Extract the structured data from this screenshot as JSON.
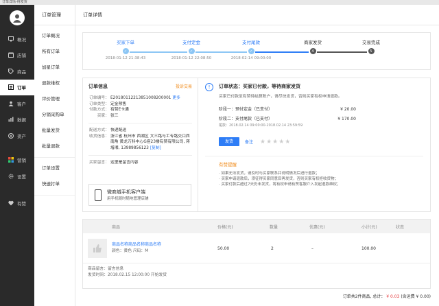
{
  "window": {
    "title": "订单详情-待发货"
  },
  "sidebar": {
    "items": [
      {
        "label": "概况",
        "icon": "monitor-icon"
      },
      {
        "label": "店铺",
        "icon": "store-icon"
      },
      {
        "label": "商品",
        "icon": "tag-icon"
      },
      {
        "label": "订单",
        "icon": "list-icon",
        "active": true
      },
      {
        "label": "客户",
        "icon": "user-icon"
      },
      {
        "label": "数据",
        "icon": "chart-icon"
      },
      {
        "label": "资产",
        "icon": "money-icon"
      },
      {
        "label": "营销",
        "icon": "grid-icon"
      },
      {
        "label": "设置",
        "icon": "gear-icon"
      },
      {
        "label": "有赞",
        "icon": "heart-icon"
      }
    ]
  },
  "subnav": {
    "title": "订单管理",
    "groups": [
      [
        "订单概况",
        "所有订单",
        "加星订单",
        "退款维权",
        "评价管理",
        "分销采购单",
        "批量发货",
        "批量退款"
      ],
      [
        "订单设置",
        "快速打单"
      ]
    ]
  },
  "main": {
    "title": "订单详情"
  },
  "steps": [
    {
      "name": "买家下单",
      "time": "2018-01-12 21:38:43",
      "state": "done",
      "mark": "✓"
    },
    {
      "name": "支付定金",
      "time": "2018-01-12 22:08:50",
      "state": "done",
      "mark": "✓"
    },
    {
      "name": "支付尾款",
      "time": "2018-02-14 09:00:00",
      "state": "done",
      "mark": "✓"
    },
    {
      "name": "商家发货",
      "time": "",
      "state": "todo",
      "mark": "4"
    },
    {
      "name": "交易完成",
      "time": "",
      "state": "todo",
      "mark": "5"
    }
  ],
  "colors": {
    "accent": "#2e7df6",
    "done_line": "#8cc6f5",
    "todo_dot": "#555555",
    "warning": "#f08c1c",
    "price": "#e4393c"
  },
  "order": {
    "title": "订单信息",
    "warning": "投诉交易",
    "fields1": [
      {
        "k": "订单编号：",
        "v": "E20180112213851008200001",
        "extra": "更多"
      },
      {
        "k": "订单类型：",
        "v": "定金预售"
      },
      {
        "k": "付款方式：",
        "v": "有赞E卡通"
      },
      {
        "k": "买家：",
        "v": "张三"
      }
    ],
    "fields2": [
      {
        "k": "配送方式：",
        "v": "快递配送"
      },
      {
        "k": "收货信息：",
        "v": "浙江省 杭州市 西湖区 文三路与工专路交口西南角 黄龙万科中心G座23楼有赞有限公司, 蒋增湘, 13989856123",
        "extra": "[复制]"
      }
    ],
    "fields3": [
      {
        "k": "买家留言：",
        "v": "这里是留言内容"
      }
    ],
    "promo_title": "微商城手机客户端",
    "promo_sub": "用手机随时随地管理店铺"
  },
  "status": {
    "title": "订单状态：买家已付款，等待商家发货",
    "desc": "买家已付款至有赞待结算账户，请尽快发货，否则买家有权申请退款。",
    "stage1_label": "阶段一：预付定金（已支付）",
    "stage1_amount": "¥ 20.00",
    "stage2_label": "阶段二：支付尾款（已支付）",
    "stage2_amount": "¥ 170.00",
    "stage2_note": "尾款：2018.02.14 09:00:00-2018.02.14 23:59:59",
    "ship_button": "发货",
    "remark_link": "备注",
    "stars": "★★★★★"
  },
  "tips": {
    "title": "有赞提醒",
    "lines": [
      "· 如果无法发货，请及时与买家联系并说明情况后进行退款；",
      "· 买家申请退款后，须征得买家同意后再发货，否则买家有权拒收货物；",
      "· 买家付款后超过7天仍未发货，将有权申请有赞客服介入发起退款维权；"
    ]
  },
  "goods": {
    "headers": {
      "product": "商品",
      "price": "价格(元)",
      "qty": "数量",
      "discount": "优惠(元)",
      "subtotal": "小计(元)",
      "status": "状态"
    },
    "row": {
      "name": "商品名称商品名称商品名称",
      "attrs": "颜色：黄色  尺码：M",
      "price": "50.00",
      "qty": "2",
      "discount": "–",
      "subtotal": "100.00"
    },
    "message": "商品留言：留言信息",
    "ship_time": "发货时间：2018.02.15 12:00:00 开始发货"
  },
  "summary": {
    "label": "订单共2件商品, 总计：",
    "total": "¥ 0.03",
    "shipping": "(含运费 ¥ 0.00)"
  }
}
